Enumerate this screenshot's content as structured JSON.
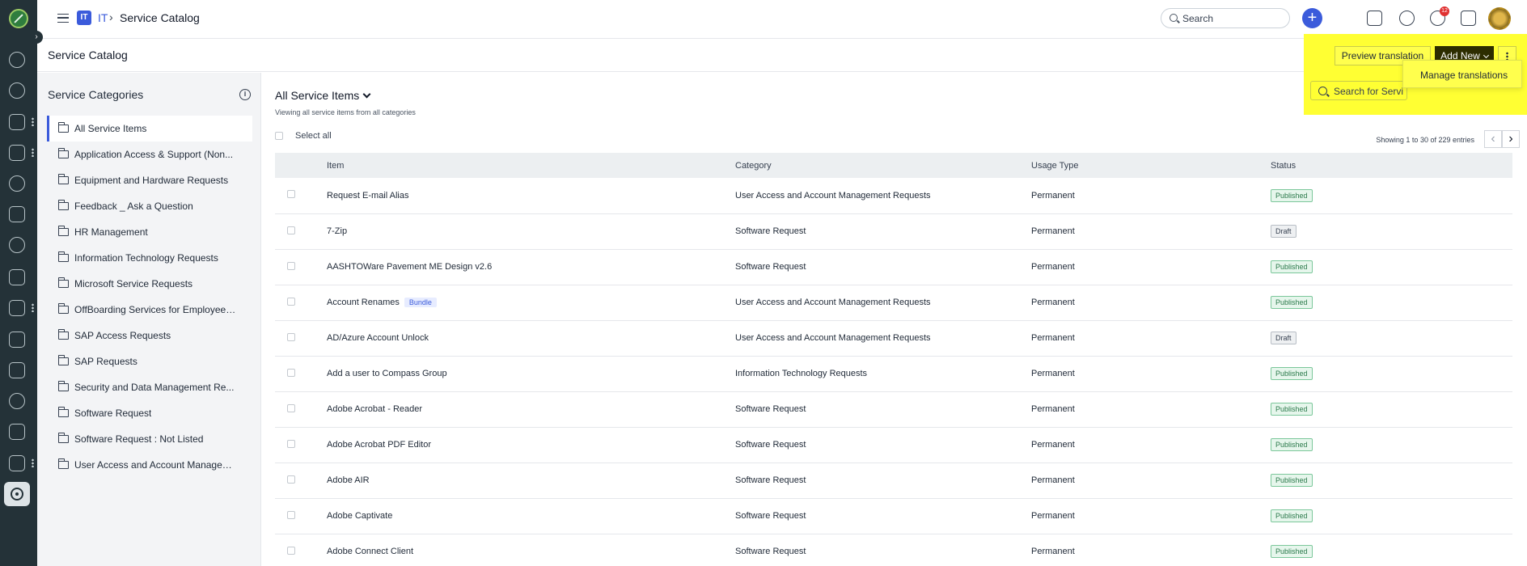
{
  "header": {
    "module_chip": "IT",
    "module_name": "IT",
    "crumb_separator": "›",
    "crumb_current": "Service Catalog",
    "search_placeholder": "Search",
    "notification_count": "12"
  },
  "page": {
    "title": "Service Catalog"
  },
  "categories": {
    "title": "Service Categories",
    "info_glyph": "i",
    "items": [
      {
        "label": "All Service Items",
        "active": true
      },
      {
        "label": "Application Access & Support (Non..."
      },
      {
        "label": "Equipment and Hardware Requests"
      },
      {
        "label": "Feedback _ Ask a Question"
      },
      {
        "label": "HR Management"
      },
      {
        "label": "Information Technology Requests"
      },
      {
        "label": "Microsoft Service Requests"
      },
      {
        "label": "OffBoarding Services for Employees..."
      },
      {
        "label": "SAP Access Requests"
      },
      {
        "label": "SAP Requests"
      },
      {
        "label": "Security and Data Management Re..."
      },
      {
        "label": "Software Request"
      },
      {
        "label": "Software Request : Not Listed"
      },
      {
        "label": "User Access and Account Managem..."
      }
    ]
  },
  "main": {
    "title": "All Service Items",
    "subtitle": "Viewing all service items from all categories",
    "select_all": "Select all",
    "entries_text": "Showing 1 to 30 of 229 entries",
    "prev_glyph": "‹",
    "next_glyph": "›"
  },
  "table": {
    "columns": [
      "Item",
      "Category",
      "Usage Type",
      "Status"
    ],
    "rows": [
      {
        "item": "Request E-mail Alias",
        "category": "User Access and Account Management Requests",
        "usage": "Permanent",
        "status": "Published"
      },
      {
        "item": "7-Zip",
        "category": "Software Request",
        "usage": "Permanent",
        "status": "Draft"
      },
      {
        "item": "AASHTOWare Pavement ME Design v2.6",
        "category": "Software Request",
        "usage": "Permanent",
        "status": "Published"
      },
      {
        "item": "Account Renames",
        "badge": "Bundle",
        "category": "User Access and Account Management Requests",
        "usage": "Permanent",
        "status": "Published"
      },
      {
        "item": "AD/Azure Account Unlock",
        "category": "User Access and Account Management Requests",
        "usage": "Permanent",
        "status": "Draft"
      },
      {
        "item": "Add a user to Compass Group",
        "category": "Information Technology Requests",
        "usage": "Permanent",
        "status": "Published"
      },
      {
        "item": "Adobe Acrobat - Reader",
        "category": "Software Request",
        "usage": "Permanent",
        "status": "Published"
      },
      {
        "item": "Adobe Acrobat PDF Editor",
        "category": "Software Request",
        "usage": "Permanent",
        "status": "Published"
      },
      {
        "item": "Adobe AIR",
        "category": "Software Request",
        "usage": "Permanent",
        "status": "Published"
      },
      {
        "item": "Adobe Captivate",
        "category": "Software Request",
        "usage": "Permanent",
        "status": "Published"
      },
      {
        "item": "Adobe Connect Client",
        "category": "Software Request",
        "usage": "Permanent",
        "status": "Published"
      }
    ]
  },
  "actions": {
    "preview_translation": "Preview translation",
    "add_new": "Add New",
    "search_placeholder": "Search for Servi",
    "menu_item": "Manage translations",
    "highlight_color": "#ffff33"
  },
  "colors": {
    "rail": "#243238",
    "accent": "#3b5bdb",
    "published": "#2b7a4b"
  }
}
